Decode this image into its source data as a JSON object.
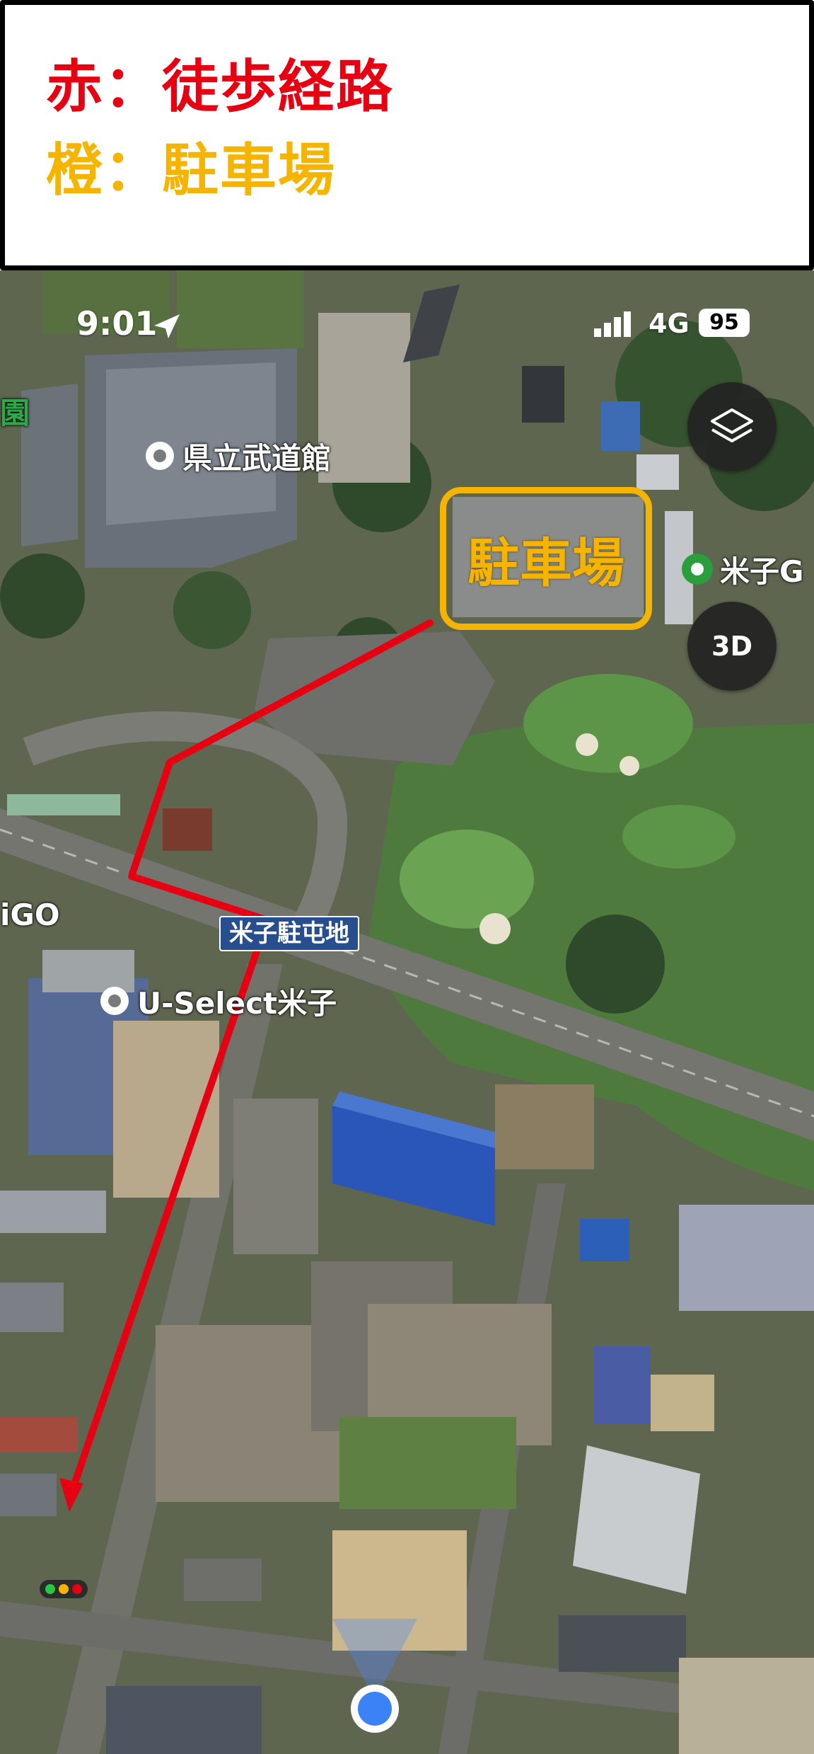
{
  "legend": {
    "walk_route": "赤：徒歩経路",
    "parking": "橙：駐車場"
  },
  "status_bar": {
    "time": "9:01",
    "network": "4G",
    "battery": "95"
  },
  "map": {
    "pois": {
      "budokan": "県立武道館",
      "golf_partial": "米子G",
      "u_select": "U-Select米子",
      "left_edge_top": "園",
      "left_edge_mid": "iGO"
    },
    "road_sign": "米子駐屯地",
    "parking_box_label": "駐車場"
  },
  "controls": {
    "layers_icon": "layers-icon",
    "three_d": "3D"
  },
  "colors": {
    "route": "#e60012",
    "parking_highlight": "#f5b400",
    "current_location": "#3b82f6"
  }
}
